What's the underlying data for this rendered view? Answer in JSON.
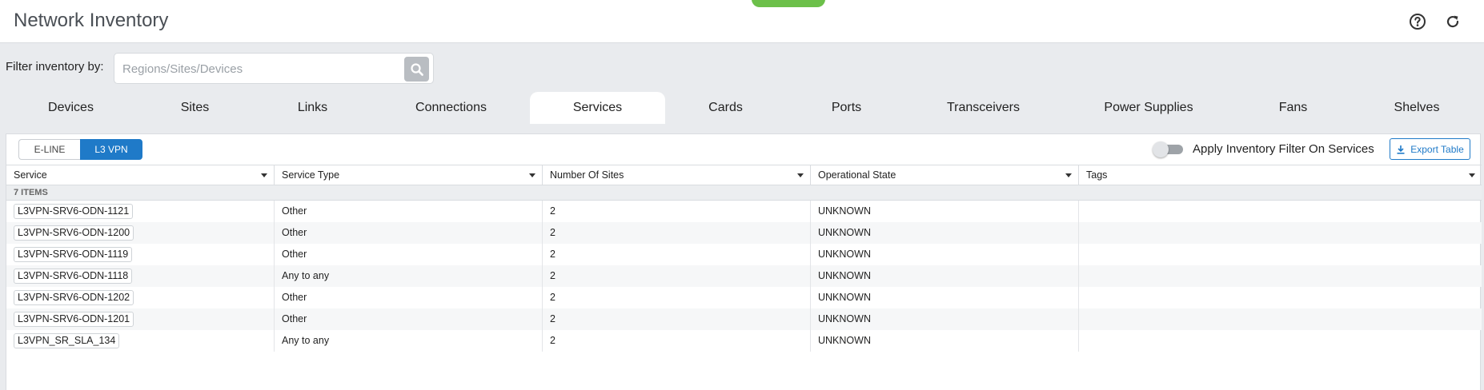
{
  "header": {
    "title": "Network Inventory",
    "help_icon": "help-circle-icon",
    "refresh_icon": "refresh-icon"
  },
  "filter": {
    "label": "Filter inventory by:",
    "placeholder": "Regions/Sites/Devices",
    "value": ""
  },
  "tabs": [
    {
      "label": "Devices",
      "active": false
    },
    {
      "label": "Sites",
      "active": false
    },
    {
      "label": "Links",
      "active": false
    },
    {
      "label": "Connections",
      "active": false
    },
    {
      "label": "Services",
      "active": true
    },
    {
      "label": "Cards",
      "active": false
    },
    {
      "label": "Ports",
      "active": false
    },
    {
      "label": "Transceivers",
      "active": false
    },
    {
      "label": "Power Supplies",
      "active": false
    },
    {
      "label": "Fans",
      "active": false
    },
    {
      "label": "Shelves",
      "active": false
    }
  ],
  "service_types": {
    "options": [
      "E-LINE",
      "L3 VPN"
    ],
    "selected": "L3 VPN"
  },
  "toggle": {
    "label": "Apply Inventory Filter On Services",
    "on": false
  },
  "export": {
    "label": "Export Table"
  },
  "table": {
    "columns": [
      "Service",
      "Service Type",
      "Number Of Sites",
      "Operational State",
      "Tags"
    ],
    "group_label": "7 ITEMS",
    "rows": [
      {
        "service": "L3VPN-SRV6-ODN-1121",
        "type": "Other",
        "sites": "2",
        "state": "UNKNOWN",
        "tags": ""
      },
      {
        "service": "L3VPN-SRV6-ODN-1200",
        "type": "Other",
        "sites": "2",
        "state": "UNKNOWN",
        "tags": ""
      },
      {
        "service": "L3VPN-SRV6-ODN-1119",
        "type": "Other",
        "sites": "2",
        "state": "UNKNOWN",
        "tags": ""
      },
      {
        "service": "L3VPN-SRV6-ODN-1118",
        "type": "Any to any",
        "sites": "2",
        "state": "UNKNOWN",
        "tags": ""
      },
      {
        "service": "L3VPN-SRV6-ODN-1202",
        "type": "Other",
        "sites": "2",
        "state": "UNKNOWN",
        "tags": ""
      },
      {
        "service": "L3VPN-SRV6-ODN-1201",
        "type": "Other",
        "sites": "2",
        "state": "UNKNOWN",
        "tags": ""
      },
      {
        "service": "L3VPN_SR_SLA_134",
        "type": "Any to any",
        "sites": "2",
        "state": "UNKNOWN",
        "tags": ""
      }
    ]
  },
  "colors": {
    "accent": "#1f7ac8",
    "status_pill": "#6cc04a",
    "background": "#e9ebee"
  }
}
